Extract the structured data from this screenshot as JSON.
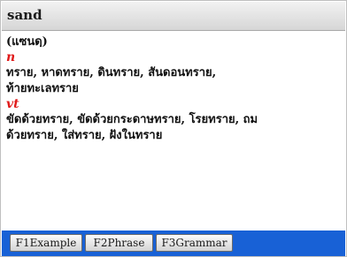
{
  "app": {
    "headword": "sand"
  },
  "entry": {
    "pronunciation": "(แซนดฺ)",
    "senses": [
      {
        "pos": "n",
        "lines": [
          "ทราย, หาดทราย, ดินทราย, สันดอนทราย,",
          "ท้ายทะเลทราย"
        ]
      },
      {
        "pos": "vt",
        "lines": [
          "ขัดด้วยทราย, ขัดด้วยกระดาษทราย, โรยทราย, ถม",
          "ด้วยทราย, ใส่ทราย, ฝังในทราย"
        ]
      }
    ]
  },
  "function_keys": [
    {
      "label": "F1Example"
    },
    {
      "label": "F2Phrase"
    },
    {
      "label": "F3Grammar"
    }
  ],
  "colors": {
    "accent": "#1861d6",
    "pos": "#e01919"
  }
}
